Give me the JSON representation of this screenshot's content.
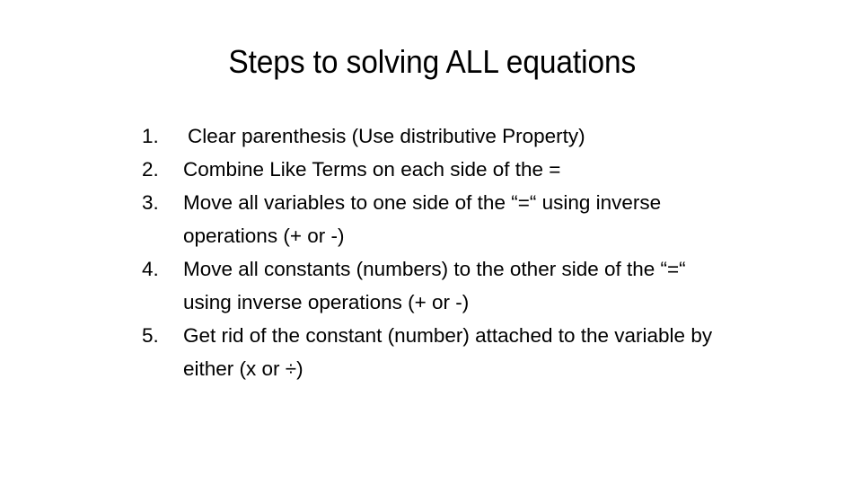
{
  "slide": {
    "title": "Steps to solving ALL equations",
    "background_color": "#ffffff",
    "text_color": "#000000",
    "steps": [
      {
        "number": "1.",
        "text": "Clear parenthesis (Use distributive Property)"
      },
      {
        "number": "2.",
        "text": "Combine Like Terms on each side of the ="
      },
      {
        "number": "3.",
        "text": "Move all variables to one side of the “=“ using inverse operations (+ or -)"
      },
      {
        "number": "4.",
        "text": "Move all constants (numbers) to the other side of the “=“ using inverse operations (+ or -)"
      },
      {
        "number": "5.",
        "text": "Get rid of the constant (number) attached to the variable by either (x or ÷)"
      }
    ]
  }
}
